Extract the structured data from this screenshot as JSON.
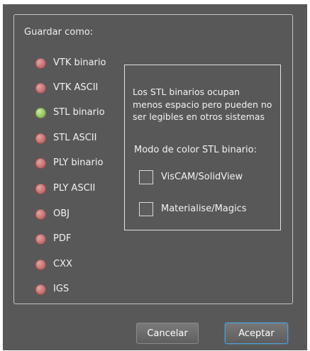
{
  "dialog": {
    "save_as_label": "Guardar como:",
    "formats": [
      {
        "label": "VTK binario",
        "selected": false
      },
      {
        "label": "VTK ASCII",
        "selected": false
      },
      {
        "label": "STL binario",
        "selected": true
      },
      {
        "label": "STL ASCII",
        "selected": false
      },
      {
        "label": "PLY binario",
        "selected": false
      },
      {
        "label": "PLY ASCII",
        "selected": false
      },
      {
        "label": "OBJ",
        "selected": false
      },
      {
        "label": "PDF",
        "selected": false
      },
      {
        "label": "CXX",
        "selected": false
      },
      {
        "label": "IGS",
        "selected": false
      }
    ],
    "info": {
      "lines": [
        "Los STL binarios ocupan",
        "menos espacio pero pueden no",
        "ser legibles en otros sistemas"
      ],
      "color_mode_label": "Modo de color STL binario:",
      "options": [
        {
          "label": "VisCAM/SolidView",
          "checked": false
        },
        {
          "label": "Materialise/Magics",
          "checked": false
        }
      ]
    },
    "buttons": {
      "cancel": "Cancelar",
      "accept": "Aceptar"
    }
  },
  "colors": {
    "dialog_background": "#585858",
    "radio_unselected": "#c56f6f",
    "radio_selected": "#93c45c",
    "accept_focus_border": "#4ea0d9"
  }
}
